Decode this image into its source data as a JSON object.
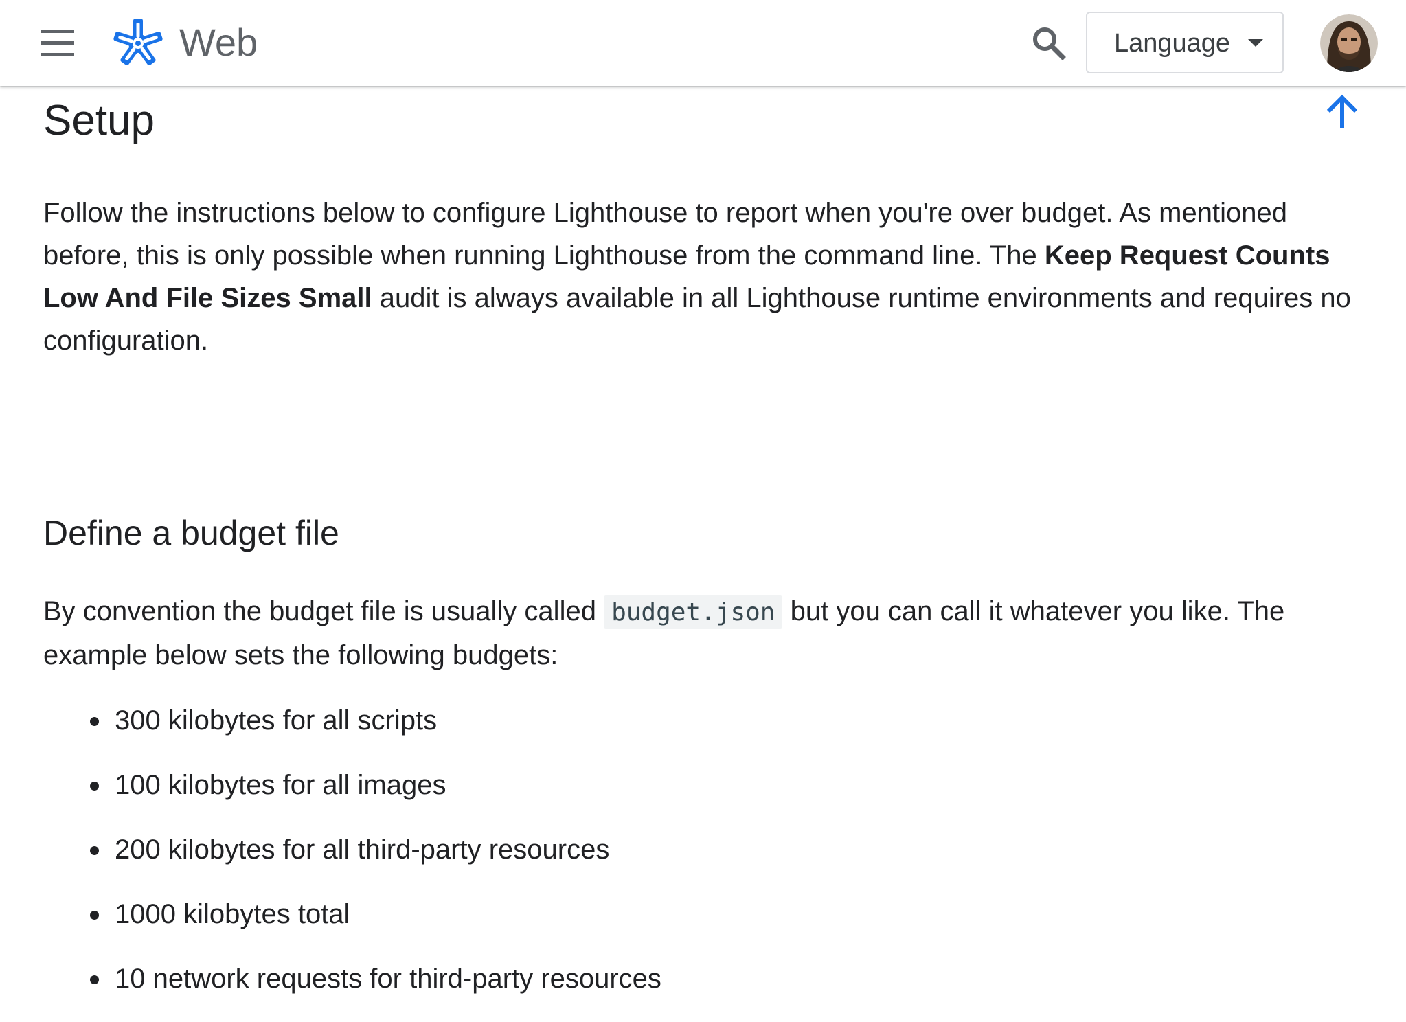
{
  "header": {
    "menu_icon": "hamburger-menu-icon",
    "logo_icon": "web-dev-asterisk-logo-icon",
    "site_title": "Web",
    "search_icon": "search-icon",
    "language_label": "Language",
    "language_caret_icon": "dropdown-caret-icon",
    "avatar_icon": "user-avatar",
    "accent_color": "#1a73e8"
  },
  "back_to_top_icon": "arrow-up-icon",
  "article": {
    "section_title": "Setup",
    "intro": {
      "part1": "Follow the instructions below to configure Lighthouse to report when you're over budget. As mentioned before, this is only possible when running Lighthouse from the command line. The ",
      "bold": "Keep Request Counts Low And File Sizes Small",
      "part2": " audit is always available in all Lighthouse runtime environments and requires no configuration."
    },
    "subsection_title": "Define a budget file",
    "budget_intro": {
      "part1": "By convention the budget file is usually called ",
      "code": "budget.json",
      "part2": " but you can call it whatever you like. The example below sets the following budgets:"
    },
    "budgets": [
      "300 kilobytes for all scripts",
      "100 kilobytes for all images",
      "200 kilobytes for all third-party resources",
      "1000 kilobytes total",
      "10 network requests for third-party resources"
    ]
  }
}
